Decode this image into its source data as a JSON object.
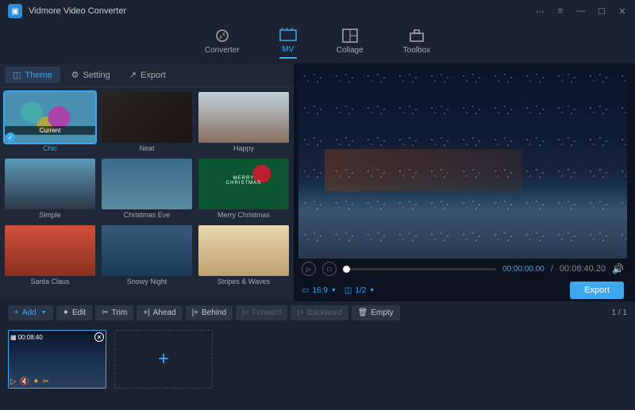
{
  "app": {
    "title": "Vidmore Video Converter"
  },
  "nav": {
    "converter": "Converter",
    "mv": "MV",
    "collage": "Collage",
    "toolbox": "Toolbox"
  },
  "subtabs": {
    "theme": "Theme",
    "setting": "Setting",
    "export": "Export"
  },
  "themes": {
    "chic": "Chic",
    "chic_cat": "Current",
    "neat": "Neat",
    "happy": "Happy",
    "simple": "Simple",
    "xmaseve": "Christmas Eve",
    "merryxmas": "Merry Christmas",
    "santa": "Santa Claus",
    "snowy": "Snowy Night",
    "stripes": "Stripes & Waves",
    "merry_label": "MERRY",
    "xmas_label": "CHRISTMAS"
  },
  "player": {
    "current_time": "00:00:00.00",
    "total_time": "00:08:40.20",
    "aspect": "16:9",
    "fraction": "1/2",
    "export": "Export"
  },
  "toolbar": {
    "add": "Add",
    "edit": "Edit",
    "trim": "Trim",
    "ahead": "Ahead",
    "behind": "Behind",
    "forward": "Forward",
    "backward": "Backward",
    "empty": "Empty",
    "pager": "1 / 1"
  },
  "clip": {
    "duration": "00:08:40"
  }
}
